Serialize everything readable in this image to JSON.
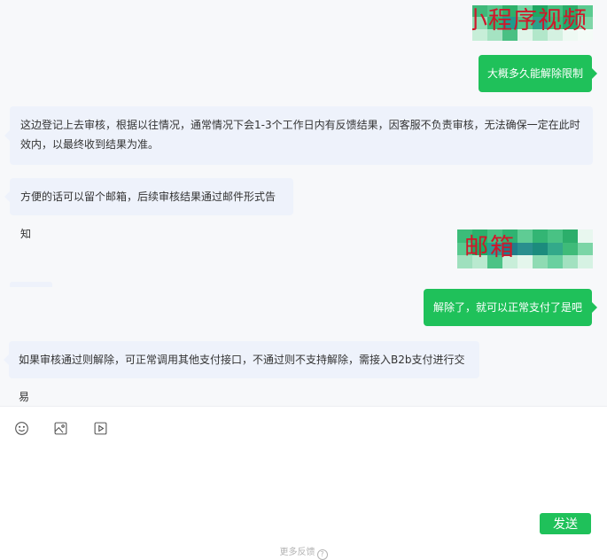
{
  "messages": {
    "user_redacted_1": "小程序视频",
    "user_1": "大概多久能解除限制",
    "agent_1": "这边登记上去审核，根据以往情况，通常情况下会1-3个工作日内有反馈结果，因客服不负责审核，无法确保一定在此时效内，以最终收到结果为准。",
    "agent_2": "方便的话可以留个邮箱，后续审核结果通过邮件形式告知",
    "user_redacted_2": "邮箱",
    "user_2": "解除了，就可以正常支付了是吧",
    "agent_3": "如果审核通过则解除，可正常调用其他支付接口，不通过则不支持解除，需接入B2b支付进行交易"
  },
  "composer": {
    "tools": [
      "emoji-icon",
      "image-icon",
      "video-icon"
    ],
    "send_label": "发送",
    "feedback_label": "更多反馈"
  },
  "colors": {
    "accent": "#1fc15a",
    "agent_bubble": "#eef2fb",
    "chat_background": "#f7f8fa",
    "redaction_text": "#d0172a"
  }
}
